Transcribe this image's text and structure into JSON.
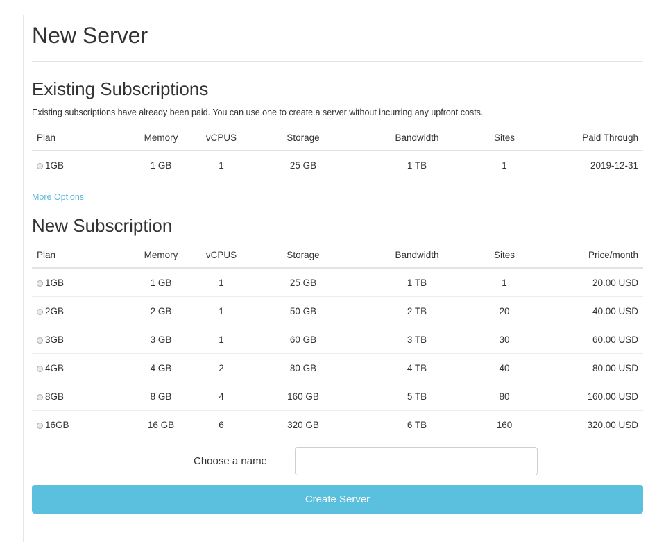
{
  "page": {
    "title": "New Server"
  },
  "existing": {
    "title": "Existing Subscriptions",
    "helper": "Existing subscriptions have already been paid. You can use one to create a server without incurring any upfront costs.",
    "columns": [
      "Plan",
      "Memory",
      "vCPUS",
      "Storage",
      "Bandwidth",
      "Sites",
      "Paid Through"
    ],
    "rows": [
      {
        "plan": "1GB",
        "memory": "1 GB",
        "vcpus": "1",
        "storage": "25 GB",
        "bandwidth": "1 TB",
        "sites": "1",
        "last": "2019-12-31"
      }
    ]
  },
  "more_options": "More Options",
  "new_sub": {
    "title": "New Subscription",
    "columns": [
      "Plan",
      "Memory",
      "vCPUS",
      "Storage",
      "Bandwidth",
      "Sites",
      "Price/month"
    ],
    "rows": [
      {
        "plan": "1GB",
        "memory": "1 GB",
        "vcpus": "1",
        "storage": "25 GB",
        "bandwidth": "1 TB",
        "sites": "1",
        "last": "20.00 USD"
      },
      {
        "plan": "2GB",
        "memory": "2 GB",
        "vcpus": "1",
        "storage": "50 GB",
        "bandwidth": "2 TB",
        "sites": "20",
        "last": "40.00 USD"
      },
      {
        "plan": "3GB",
        "memory": "3 GB",
        "vcpus": "1",
        "storage": "60 GB",
        "bandwidth": "3 TB",
        "sites": "30",
        "last": "60.00 USD"
      },
      {
        "plan": "4GB",
        "memory": "4 GB",
        "vcpus": "2",
        "storage": "80 GB",
        "bandwidth": "4 TB",
        "sites": "40",
        "last": "80.00 USD"
      },
      {
        "plan": "8GB",
        "memory": "8 GB",
        "vcpus": "4",
        "storage": "160 GB",
        "bandwidth": "5 TB",
        "sites": "80",
        "last": "160.00 USD"
      },
      {
        "plan": "16GB",
        "memory": "16 GB",
        "vcpus": "6",
        "storage": "320 GB",
        "bandwidth": "6 TB",
        "sites": "160",
        "last": "320.00 USD"
      }
    ]
  },
  "name_field": {
    "label": "Choose a name",
    "value": "",
    "placeholder": ""
  },
  "create_button": "Create Server",
  "colors": {
    "accent": "#5bc0de",
    "link": "#5bb8db"
  }
}
